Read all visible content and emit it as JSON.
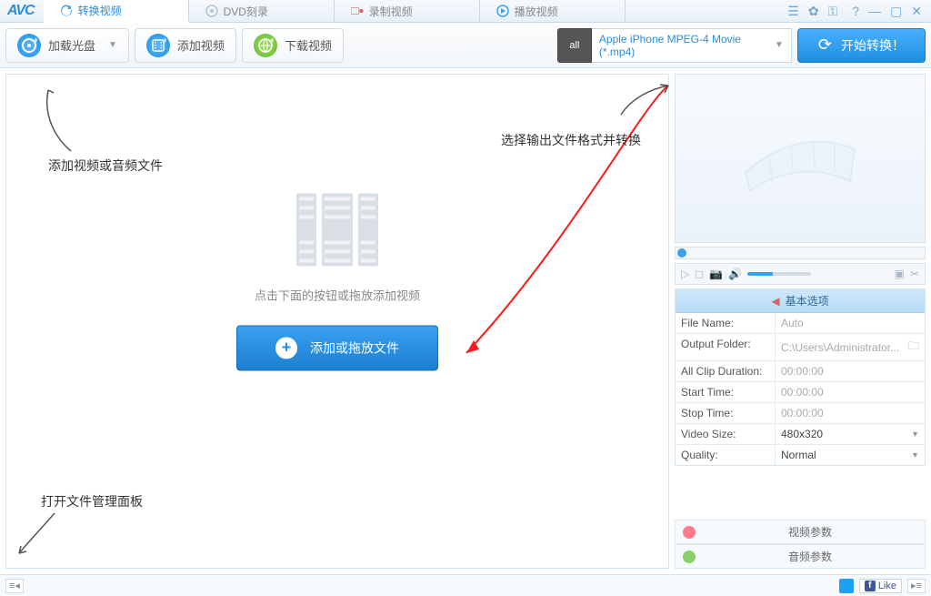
{
  "logo": "AVC",
  "tabs": [
    {
      "label": "转换视频"
    },
    {
      "label": "DVD刻录"
    },
    {
      "label": "录制视频"
    },
    {
      "label": "播放视频"
    }
  ],
  "toolbar": {
    "load_disc": "加载光盘",
    "add_video": "添加视频",
    "download_video": "下载视频",
    "profile_label": "Apple iPhone MPEG-4 Movie (*.mp4)",
    "profile_icon": "all",
    "start_convert": "开始转换！"
  },
  "dropzone": {
    "hint": "点击下面的按钮或拖放添加视频",
    "button": "添加或拖放文件"
  },
  "annotations": {
    "add_files": "添加视频或音频文件",
    "select_output": "选择输出文件格式并转换",
    "open_panel": "打开文件管理面板"
  },
  "properties": {
    "header": "基本选项",
    "rows": [
      {
        "k": "File Name:",
        "v": "Auto"
      },
      {
        "k": "Output Folder:",
        "v": "C:\\Users\\Administrator..."
      },
      {
        "k": "All Clip Duration:",
        "v": "00:00:00"
      },
      {
        "k": "Start Time:",
        "v": "00:00:00"
      },
      {
        "k": "Stop Time:",
        "v": "00:00:00"
      },
      {
        "k": "Video Size:",
        "v": "480x320",
        "sel": true
      },
      {
        "k": "Quality:",
        "v": "Normal",
        "sel": true
      }
    ],
    "video_params": "视频参数",
    "audio_params": "音频参数"
  },
  "status": {
    "like": "Like"
  }
}
